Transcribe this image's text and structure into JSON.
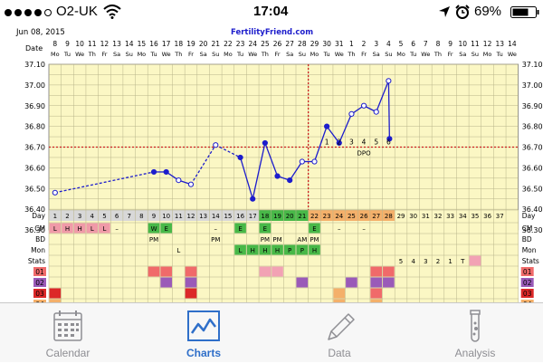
{
  "status_bar": {
    "carrier": "O2-UK",
    "time": "17:04",
    "battery": "69%",
    "signal_icon": "signal-dots-icon",
    "wifi_icon": "wifi-icon",
    "location_icon": "location-arrow-icon",
    "alarm_icon": "alarm-clock-icon",
    "battery_icon": "battery-icon"
  },
  "chart_header": {
    "date": "Jun 08, 2015",
    "brand": "FertilityFriend.com"
  },
  "colors": {
    "chart_bg": "#fbf7c4",
    "grid": "#b8b48a",
    "line": "#1d1dcc",
    "coverline": "#cc2222",
    "green": "#48b848",
    "pink": "#f09aa8",
    "orange": "#f4b06a",
    "red": "#dc2828",
    "purple": "#9a5ab8",
    "salmon": "#f06a6a",
    "rose": "#f2a2b4",
    "accent": "#2f6fc9"
  },
  "chart_data": {
    "type": "line",
    "title": "",
    "xlabel": "Day",
    "ylabel": "",
    "ylim": [
      36.3,
      37.1
    ],
    "yticks": [
      "37.10",
      "37.00",
      "36.90",
      "36.80",
      "36.70",
      "36.60",
      "36.50",
      "36.40",
      "36.30"
    ],
    "date_numbers": [
      "8",
      "9",
      "10",
      "11",
      "12",
      "13",
      "14",
      "15",
      "16",
      "17",
      "18",
      "19",
      "20",
      "21",
      "22",
      "23",
      "24",
      "25",
      "26",
      "27",
      "28",
      "29",
      "30",
      "31",
      "1",
      "2",
      "3",
      "4",
      "5",
      "6",
      "7",
      "8",
      "9",
      "10",
      "11",
      "12",
      "13",
      "14"
    ],
    "weekdays": [
      "Mo",
      "Tu",
      "We",
      "Th",
      "Fr",
      "Sa",
      "Su",
      "Mo",
      "Tu",
      "We",
      "Th",
      "Fr",
      "Sa",
      "Su",
      "Mo",
      "Tu",
      "We",
      "Th",
      "Fr",
      "Sa",
      "Su",
      "Mo",
      "Tu",
      "We",
      "Th",
      "Fr",
      "Sa",
      "Su",
      "Mo",
      "Tu",
      "We",
      "Th",
      "Fr",
      "Sa",
      "Su",
      "Mo",
      "Tu",
      "We"
    ],
    "cycle_days": [
      "1",
      "2",
      "3",
      "4",
      "5",
      "6",
      "7",
      "8",
      "9",
      "10",
      "11",
      "12",
      "13",
      "14",
      "15",
      "16",
      "17",
      "18",
      "19",
      "20",
      "21",
      "22",
      "23",
      "24",
      "25",
      "26",
      "27",
      "28",
      "29",
      "30",
      "31",
      "32",
      "33",
      "34",
      "35",
      "36",
      "37"
    ],
    "coverline": 36.7,
    "ovulation_day": 21,
    "series": [
      {
        "days": [
          1,
          9,
          10,
          11,
          12,
          14,
          16,
          17,
          18,
          19,
          20,
          21,
          22,
          23,
          24,
          25,
          26,
          27,
          28
        ],
        "values": [
          36.48,
          36.58,
          36.58,
          36.54,
          36.52,
          36.71,
          36.65,
          36.45,
          36.72,
          36.56,
          36.54,
          36.63,
          36.63,
          36.8,
          36.72,
          36.86,
          36.9,
          36.87,
          37.02
        ],
        "open_points": [
          1,
          11,
          12,
          14,
          21,
          22,
          25,
          26,
          27,
          28
        ]
      }
    ],
    "final_point": {
      "day": 28,
      "value": 36.74
    },
    "dpo_markers": [
      {
        "day": 23,
        "label": "1"
      },
      {
        "day": 24,
        "label": "2"
      },
      {
        "day": 25,
        "label": "3"
      },
      {
        "day": 26,
        "label": "4"
      },
      {
        "day": 27,
        "label": "5"
      },
      {
        "day": 28,
        "label": "6"
      }
    ],
    "dpo_label": "DPO",
    "row_labels": {
      "day": "Day",
      "cm": "CM",
      "bd": "BD",
      "mon": "Mon",
      "stats": "Stats",
      "r01": "01",
      "r02": "02",
      "r03": "03",
      "r04": "04"
    },
    "day_row_colors": {
      "grey": [
        1,
        2,
        3,
        4,
        5,
        6,
        7,
        8,
        9,
        10,
        11,
        12,
        13,
        14,
        15,
        16,
        17
      ],
      "green": [
        18,
        19,
        20,
        21
      ],
      "orange": [
        22,
        23,
        24,
        25,
        26,
        27,
        28
      ]
    },
    "period_cells": [
      {
        "day": 1,
        "label": "L"
      },
      {
        "day": 2,
        "label": "H"
      },
      {
        "day": 3,
        "label": "H"
      },
      {
        "day": 4,
        "label": "L"
      },
      {
        "day": 5,
        "label": "L"
      }
    ],
    "cm_cells": [
      {
        "day": 6,
        "label": "–",
        "color": ""
      },
      {
        "day": 9,
        "label": "W",
        "color": "green"
      },
      {
        "day": 10,
        "label": "E",
        "color": "green"
      },
      {
        "day": 14,
        "label": "–",
        "color": ""
      },
      {
        "day": 16,
        "label": "E",
        "color": "green"
      },
      {
        "day": 18,
        "label": "E",
        "color": "green"
      },
      {
        "day": 22,
        "label": "E",
        "color": "green"
      },
      {
        "day": 24,
        "label": "–",
        "color": ""
      },
      {
        "day": 26,
        "label": "–",
        "color": ""
      }
    ],
    "bd_cells": [
      {
        "day": 9,
        "label": "PM"
      },
      {
        "day": 14,
        "label": "PM"
      },
      {
        "day": 18,
        "label": "PM"
      },
      {
        "day": 19,
        "label": "PM"
      },
      {
        "day": 21,
        "label": "AM"
      },
      {
        "day": 22,
        "label": "PM"
      }
    ],
    "mon_cells": [
      {
        "day": 11,
        "label": "L",
        "color": ""
      },
      {
        "day": 16,
        "label": "L",
        "color": ""
      },
      {
        "day": 17,
        "label": "H",
        "color": "green"
      },
      {
        "day": 18,
        "label": "H",
        "color": "green"
      },
      {
        "day": 19,
        "label": "H",
        "color": "green"
      },
      {
        "day": 20,
        "label": "P",
        "color": "green"
      },
      {
        "day": 21,
        "label": "P",
        "color": "green"
      },
      {
        "day": 22,
        "label": "H",
        "color": "green"
      }
    ],
    "mon_blank_green": [
      16,
      17,
      18
    ],
    "stats_cells": [
      {
        "day": 29,
        "label": "5"
      },
      {
        "day": 30,
        "label": "4"
      },
      {
        "day": 31,
        "label": "3"
      },
      {
        "day": 32,
        "label": "2"
      },
      {
        "day": 33,
        "label": "1"
      },
      {
        "day": 34,
        "label": "T"
      }
    ],
    "stats_pink_day": 35,
    "symptom_cells": [
      {
        "row": 1,
        "day": 9,
        "color": "salmon"
      },
      {
        "row": 1,
        "day": 10,
        "color": "salmon"
      },
      {
        "row": 1,
        "day": 12,
        "color": "salmon"
      },
      {
        "row": 1,
        "day": 18,
        "color": "rose"
      },
      {
        "row": 1,
        "day": 19,
        "color": "rose"
      },
      {
        "row": 1,
        "day": 27,
        "color": "salmon"
      },
      {
        "row": 1,
        "day": 28,
        "color": "salmon"
      },
      {
        "row": 2,
        "day": 10,
        "color": "purple"
      },
      {
        "row": 2,
        "day": 12,
        "color": "purple"
      },
      {
        "row": 2,
        "day": 21,
        "color": "purple"
      },
      {
        "row": 2,
        "day": 25,
        "color": "purple"
      },
      {
        "row": 2,
        "day": 27,
        "color": "purple"
      },
      {
        "row": 2,
        "day": 28,
        "color": "purple"
      },
      {
        "row": 3,
        "day": 1,
        "color": "red"
      },
      {
        "row": 3,
        "day": 12,
        "color": "red"
      },
      {
        "row": 3,
        "day": 24,
        "color": "orange"
      },
      {
        "row": 3,
        "day": 27,
        "color": "salmon"
      },
      {
        "row": 4,
        "day": 1,
        "color": "orange"
      },
      {
        "row": 4,
        "day": 24,
        "color": "orange"
      },
      {
        "row": 4,
        "day": 27,
        "color": "orange"
      }
    ]
  },
  "tabs": [
    {
      "label": "Calendar",
      "icon": "calendar-icon",
      "active": false
    },
    {
      "label": "Charts",
      "icon": "chart-line-icon",
      "active": true
    },
    {
      "label": "Data",
      "icon": "pencil-icon",
      "active": false
    },
    {
      "label": "Analysis",
      "icon": "test-tube-icon",
      "active": false
    }
  ]
}
